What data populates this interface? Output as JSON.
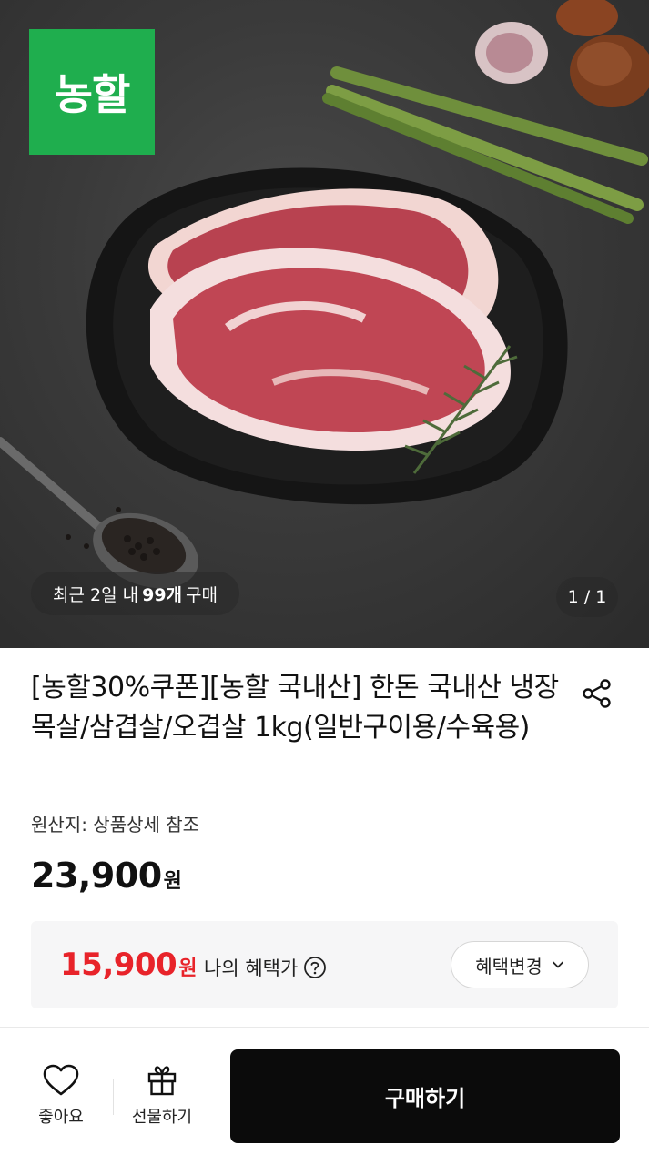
{
  "hero": {
    "brand": "농할",
    "recent_prefix": "최근 2일 내",
    "recent_count": "99개",
    "recent_suffix": "구매",
    "pager": "1 / 1"
  },
  "product": {
    "title": "[농할30%쿠폰][농할 국내산] 한돈 국내산 냉장 목살/삼겹살/오겹살 1kg(일반구이용/수육용)",
    "origin": "원산지: 상품상세 참조",
    "price": "23,900",
    "price_unit": "원"
  },
  "benefit": {
    "price": "15,900",
    "price_unit": "원",
    "label": "나의 혜택가",
    "change_label": "혜택변경"
  },
  "bottom_bar": {
    "like_label": "좋아요",
    "gift_label": "선물하기",
    "buy_label": "구매하기"
  },
  "colors": {
    "brand_green": "#1fae4e",
    "benefit_red": "#e8232a",
    "buy_button": "#0b0b0b"
  },
  "icons": [
    "share-icon",
    "question-circle-icon",
    "chevron-down-icon",
    "heart-icon",
    "gift-icon"
  ]
}
